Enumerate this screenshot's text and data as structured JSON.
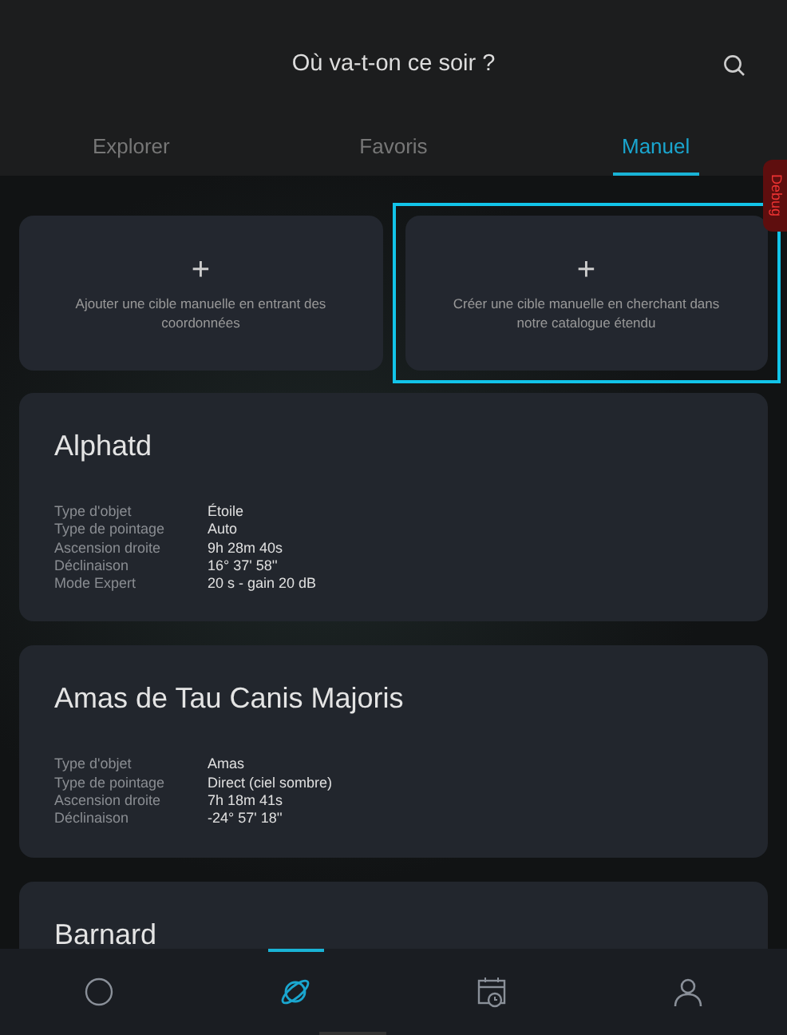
{
  "header": {
    "title": "Où va-t-on ce soir ?"
  },
  "tabs": [
    {
      "label": "Explorer",
      "selected": false
    },
    {
      "label": "Favoris",
      "selected": false
    },
    {
      "label": "Manuel",
      "selected": true
    }
  ],
  "debug_tab": {
    "label": "Debug"
  },
  "add_cards": [
    {
      "icon": "+",
      "text": "Ajouter une cible manuelle en entrant des coordonnées",
      "selected": false
    },
    {
      "icon": "+",
      "text": "Créer une cible manuelle en cherchant dans notre catalogue étendu",
      "selected": true
    }
  ],
  "targets": [
    {
      "name": "Alphatd",
      "details": [
        {
          "label": "Type d'objet",
          "value": "Étoile"
        },
        {
          "label": "Type de pointage",
          "value": "Auto"
        },
        {
          "label": "Ascension droite",
          "value": "9h 28m 40s"
        },
        {
          "label": "Déclinaison",
          "value": "16° 37' 58''"
        },
        {
          "label": "Mode Expert",
          "value": "20 s - gain 20 dB"
        }
      ]
    },
    {
      "name": "Amas de Tau Canis Majoris",
      "details": [
        {
          "label": "Type d'objet",
          "value": "Amas"
        },
        {
          "label": "Type de pointage",
          "value": "Direct (ciel sombre)"
        },
        {
          "label": "Ascension droite",
          "value": "7h 18m 41s"
        },
        {
          "label": "Déclinaison",
          "value": "-24° 57' 18''"
        }
      ]
    },
    {
      "name": "Barnard"
    }
  ],
  "bottom_nav": [
    {
      "kind": "circle",
      "selected": false
    },
    {
      "kind": "planet",
      "selected": true
    },
    {
      "kind": "calendar",
      "selected": false
    },
    {
      "kind": "user",
      "selected": false
    }
  ]
}
